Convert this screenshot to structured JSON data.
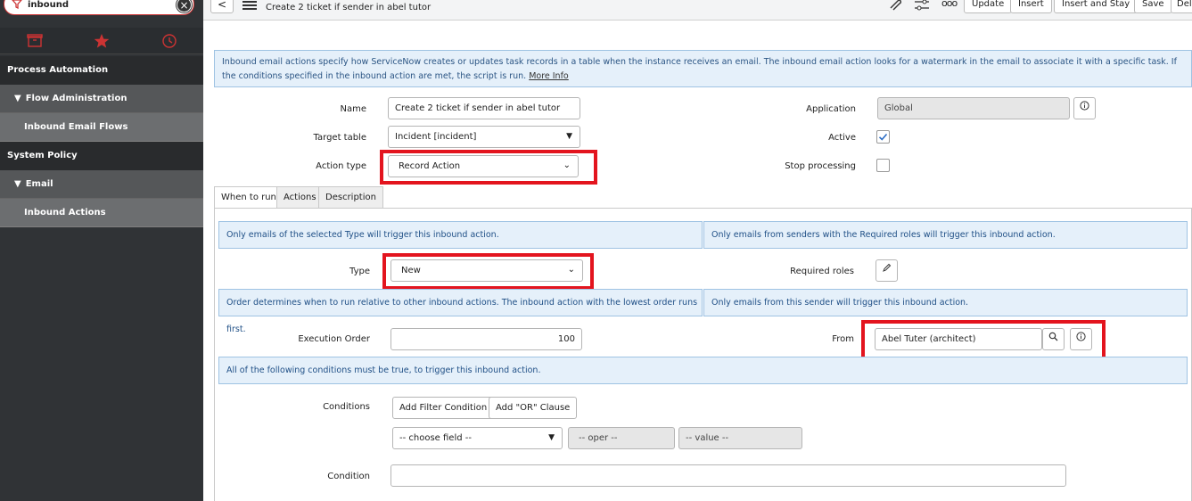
{
  "sidebar": {
    "filter_value": "inbound",
    "tabs": [
      "all-apps-icon",
      "favorites-star-icon",
      "history-clock-icon"
    ],
    "nav": [
      {
        "label": "Process Automation",
        "kind": "app"
      },
      {
        "label": "Flow Administration",
        "kind": "module"
      },
      {
        "label": "Inbound Email Flows",
        "kind": "item"
      },
      {
        "label": "System Policy",
        "kind": "app"
      },
      {
        "label": "Email",
        "kind": "module"
      },
      {
        "label": "Inbound Actions",
        "kind": "item"
      }
    ]
  },
  "header": {
    "record_title": "Create 2 ticket if sender in abel tutor",
    "buttons": [
      "Update",
      "Insert",
      "Insert and Stay",
      "Save",
      "Del"
    ]
  },
  "form": {
    "intro_text": "Inbound email actions specify how ServiceNow creates or updates task records in a table when the instance receives an email. The inbound email action looks for a watermark in the email to associate it with a specific task. If the conditions specified in the inbound action are met, the script is run.",
    "more_info": "More Info",
    "name_label": "Name",
    "name_value": "Create 2 ticket if sender in abel tutor",
    "target_table_label": "Target table",
    "target_table_value": "Incident [incident]",
    "action_type_label": "Action type",
    "action_type_value": "Record Action",
    "application_label": "Application",
    "application_value": "Global",
    "active_label": "Active",
    "active_checked": true,
    "stop_processing_label": "Stop processing",
    "stop_processing_checked": false
  },
  "tabs": [
    "When to run",
    "Actions",
    "Description"
  ],
  "when_to_run": {
    "type_info": "Only emails of the selected Type will trigger this inbound action.",
    "roles_info": "Only emails from senders with the Required roles will trigger this inbound action.",
    "type_label": "Type",
    "type_value": "New",
    "required_roles_label": "Required roles",
    "order_info": "Order determines when to run relative to other inbound actions. The inbound action with the lowest order runs first.",
    "sender_info": "Only emails from this sender will trigger this inbound action.",
    "execution_order_label": "Execution Order",
    "execution_order_value": "100",
    "from_label": "From",
    "from_value": "Abel Tuter (architect)",
    "conditions_info": "All of the following conditions must be true, to trigger this inbound action.",
    "conditions_label": "Conditions",
    "add_filter_label": "Add Filter Condition",
    "add_or_label": "Add \"OR\" Clause",
    "choose_field": "-- choose field --",
    "oper": "-- oper --",
    "value": "-- value --",
    "condition_label": "Condition"
  },
  "colors": {
    "highlight": "#e3141e",
    "sidebar": "#303336",
    "info_bg": "#e5f0fa"
  }
}
